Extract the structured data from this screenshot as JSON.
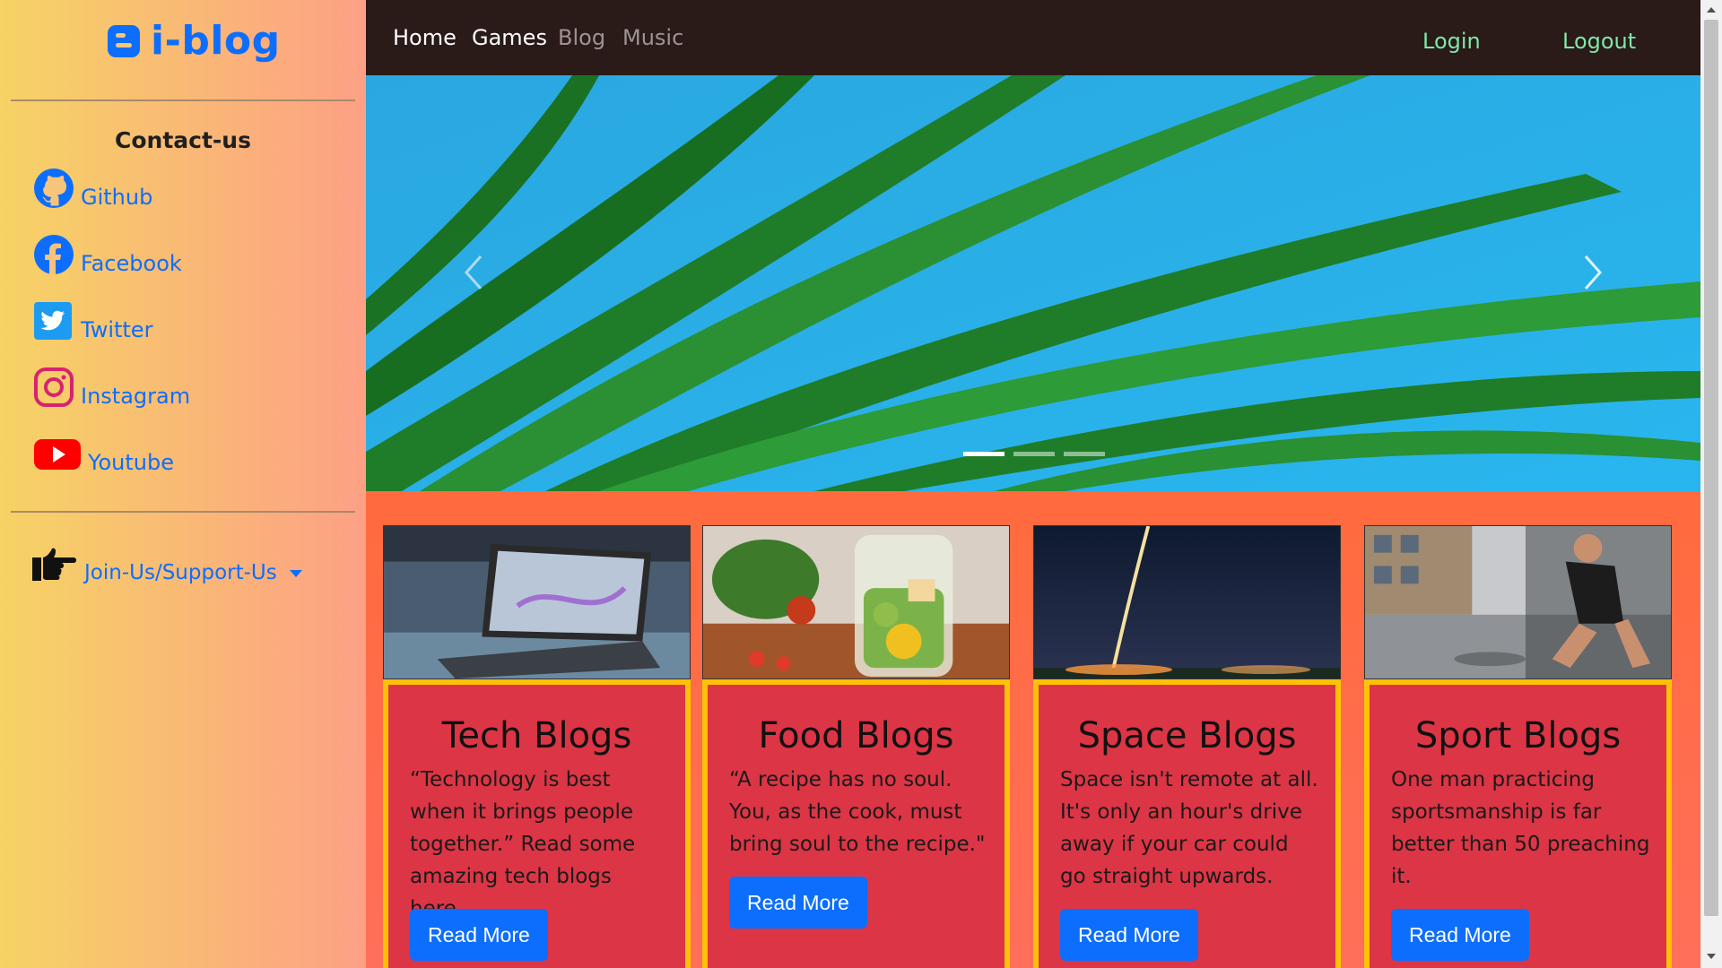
{
  "sidebar": {
    "brand": "i-blog",
    "contact_title": "Contact-us",
    "social": [
      {
        "label": "Github",
        "icon": "github-icon"
      },
      {
        "label": "Facebook",
        "icon": "facebook-icon"
      },
      {
        "label": "Twitter",
        "icon": "twitter-icon"
      },
      {
        "label": "Instagram",
        "icon": "instagram-icon"
      },
      {
        "label": "Youtube",
        "icon": "youtube-icon"
      }
    ],
    "join_label": "Join-Us/Support-Us"
  },
  "nav": {
    "home": "Home",
    "games": "Games",
    "blog": "Blog",
    "music": "Music",
    "login": "Login",
    "logout": "Logout"
  },
  "carousel": {
    "slides": 3,
    "active_slide": 1
  },
  "cards": [
    {
      "title": "Tech Blogs",
      "text": "“Technology is best when it brings people together.” Read some amazing tech blogs here.",
      "button": "Read More"
    },
    {
      "title": "Food Blogs",
      "text": "“A recipe has no soul. You, as the cook, must bring soul to the recipe.\"",
      "button": "Read More"
    },
    {
      "title": "Space Blogs",
      "text": "Space isn't remote at all. It's only an hour's drive away if your car could go straight upwards.",
      "button": "Read More"
    },
    {
      "title": "Sport Blogs",
      "text": "One man practicing sportsmanship is far better than 50 preaching it.",
      "button": "Read More"
    }
  ],
  "colors": {
    "accent": "#0d6efd",
    "card_bg": "#dc3545",
    "card_border": "#ffc107",
    "nav_bg": "#2a1a18",
    "login_color": "#7ee8a8"
  }
}
